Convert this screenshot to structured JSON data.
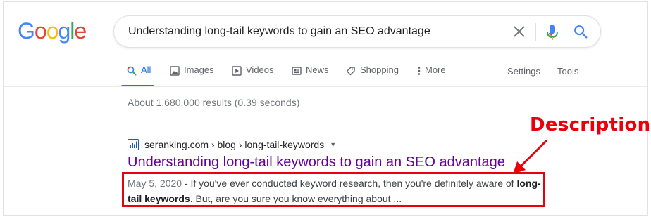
{
  "logo": {
    "letters": [
      "G",
      "o",
      "o",
      "g",
      "l",
      "e"
    ],
    "colors": [
      "#4285f4",
      "#ea4335",
      "#fbbc05",
      "#4285f4",
      "#34a853",
      "#ea4335"
    ]
  },
  "search": {
    "query": "Understanding long-tail keywords to gain an SEO advantage",
    "clear_icon": "close-icon",
    "voice_icon": "microphone-icon",
    "submit_icon": "search-icon"
  },
  "tabs": [
    {
      "label": "All",
      "icon": "search-icon",
      "active": true
    },
    {
      "label": "Images",
      "icon": "image-icon"
    },
    {
      "label": "Videos",
      "icon": "play-icon"
    },
    {
      "label": "News",
      "icon": "newspaper-icon"
    },
    {
      "label": "Shopping",
      "icon": "tag-icon"
    },
    {
      "label": "More",
      "icon": "more-vertical-icon"
    }
  ],
  "tools": {
    "settings": "Settings",
    "tools": "Tools"
  },
  "stats": "About 1,680,000 results (0.39 seconds)",
  "result": {
    "breadcrumb": "seranking.com › blog › long-tail-keywords",
    "caret": "▼",
    "title": "Understanding long-tail keywords to gain an SEO advantage",
    "date": "May 5, 2020",
    "sep": " - ",
    "snippet_1": "If you've ever conducted keyword research, then you're definitely aware of ",
    "bold_1": "long-",
    "bold_2": "tail keywords",
    "snippet_2": ". But, are you sure you know everything about ..."
  },
  "annotation": {
    "label": "Description",
    "color": "#e8000b"
  },
  "colors": {
    "accent": "#1a73e8",
    "visited_link": "#660099",
    "annotation": "#e8000b"
  }
}
